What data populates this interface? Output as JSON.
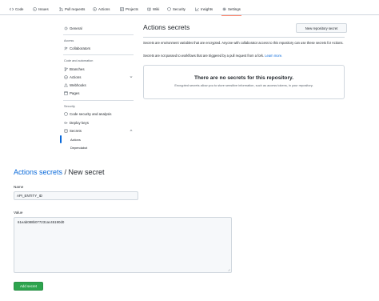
{
  "repo_tabs": [
    {
      "label": "Code",
      "icon": "code-icon"
    },
    {
      "label": "Issues",
      "icon": "issue-icon"
    },
    {
      "label": "Pull requests",
      "icon": "pull-request-icon"
    },
    {
      "label": "Actions",
      "icon": "play-icon"
    },
    {
      "label": "Projects",
      "icon": "table-icon"
    },
    {
      "label": "Wiki",
      "icon": "book-icon"
    },
    {
      "label": "Security",
      "icon": "shield-icon"
    },
    {
      "label": "Insights",
      "icon": "graph-icon"
    },
    {
      "label": "Settings",
      "icon": "gear-icon",
      "selected": true
    }
  ],
  "sidebar": {
    "general": "General",
    "access_heading": "Access",
    "collaborators": "Collaborators",
    "code_heading": "Code and automation",
    "branches": "Branches",
    "actions": "Actions",
    "webhooks": "Webhooks",
    "pages": "Pages",
    "security_heading": "Security",
    "code_security": "Code security and analysis",
    "deploy_keys": "Deploy keys",
    "secrets": "Secrets",
    "secrets_actions": "Actions",
    "secrets_dependabot": "Dependabot"
  },
  "main": {
    "title": "Actions secrets",
    "new_secret_button": "New repository secret",
    "description": "Secrets are environment variables that are encrypted. Anyone with collaborator access to this repository can use these secrets for Actions.",
    "fork_note": "Secrets are not passed to workflows that are triggered by a pull request from a fork.",
    "learn_more": "Learn more.",
    "empty_title": "There are no secrets for this repository.",
    "empty_subtitle": "Encrypted secrets allow you to store sensitive information, such as access tokens, in your repository."
  },
  "form": {
    "breadcrumb_link": "Actions secrets",
    "breadcrumb_sep": " / ",
    "breadcrumb_current": "New secret",
    "name_label": "Name",
    "name_value": "API_ENTITY_ID",
    "value_label": "Value",
    "value_value": "61eab088b077231ac45190d0",
    "submit": "Add secret"
  },
  "colors": {
    "accent": "#0969da",
    "selected_tab_underline": "#fd8c73",
    "primary_button": "#2da44e",
    "border": "#d0d7de"
  }
}
